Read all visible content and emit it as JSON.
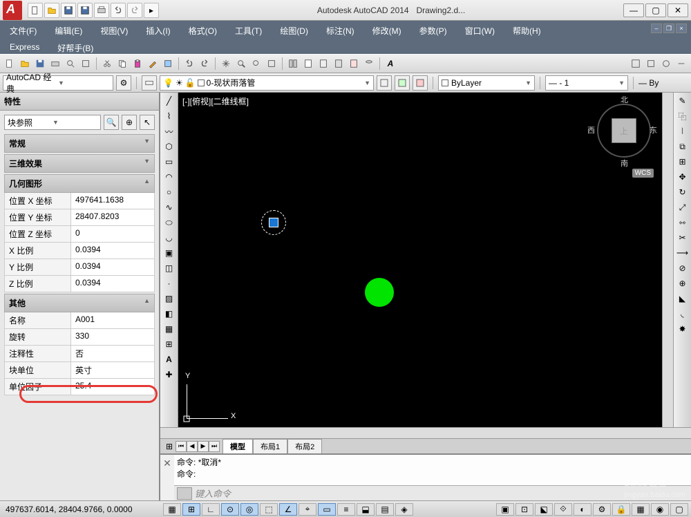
{
  "app": {
    "title": "Autodesk AutoCAD 2014",
    "document": "Drawing2.d..."
  },
  "menu": {
    "row1": [
      "文件(F)",
      "编辑(E)",
      "视图(V)",
      "插入(I)",
      "格式(O)",
      "工具(T)",
      "绘图(D)",
      "标注(N)",
      "修改(M)",
      "参数(P)",
      "窗口(W)",
      "帮助(H)"
    ],
    "row2": [
      "Express",
      "好帮手(B)"
    ]
  },
  "workspace": {
    "label": "AutoCAD 经典"
  },
  "layer": {
    "name": "0-现状雨落管",
    "square_glyph": "□"
  },
  "color_ctl": {
    "label": "ByLayer"
  },
  "linetype_ctl": {
    "label": "— - 1"
  },
  "lw_ctl": {
    "label": "— By"
  },
  "props": {
    "title": "特性",
    "object_type": "块参照",
    "cats": {
      "general": "常规",
      "fx3d": "三维效果",
      "geometry": "几何图形",
      "other": "其他"
    },
    "geometry": [
      {
        "label": "位置 X 坐标",
        "value": "497641.1638"
      },
      {
        "label": "位置 Y 坐标",
        "value": "28407.8203"
      },
      {
        "label": "位置 Z 坐标",
        "value": "0"
      },
      {
        "label": "X 比例",
        "value": "0.0394"
      },
      {
        "label": "Y 比例",
        "value": "0.0394"
      },
      {
        "label": "Z 比例",
        "value": "0.0394"
      }
    ],
    "other": [
      {
        "label": "名称",
        "value": "A001"
      },
      {
        "label": "旋转",
        "value": "330"
      },
      {
        "label": "注释性",
        "value": "否"
      },
      {
        "label": "块单位",
        "value": "英寸"
      },
      {
        "label": "单位因子",
        "value": "25.4"
      }
    ]
  },
  "viewport": {
    "label": "[-][俯视][二维线框]",
    "cube_dirs": {
      "n": "北",
      "s": "南",
      "e": "东",
      "w": "西"
    },
    "wcs": "WCS",
    "axis_x": "X",
    "axis_y": "Y",
    "cube_face": "上"
  },
  "tabs": {
    "model": "模型",
    "layout1": "布局1",
    "layout2": "布局2"
  },
  "cmd": {
    "line1_label": "命令:",
    "line1_text": "*取消*",
    "line2_label": "命令:",
    "placeholder": "键入命令"
  },
  "status": {
    "coords": "497637.6014, 28404.9766, 0.0000"
  },
  "watermark": {
    "brand": "Baidu 经验",
    "sub": "jingyan.baidu.com"
  }
}
